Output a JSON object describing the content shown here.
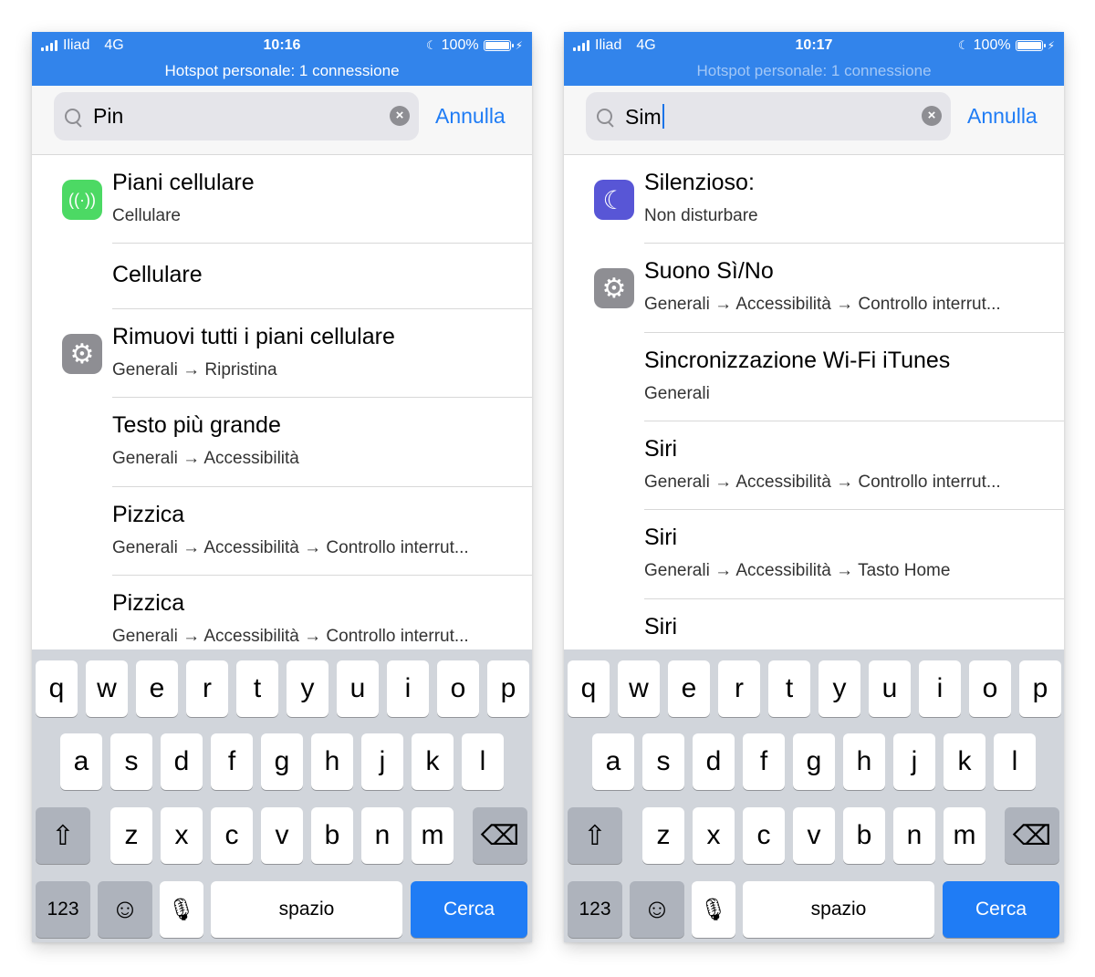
{
  "phones": [
    {
      "status": {
        "carrier": "Iliad",
        "network": "4G",
        "time": "10:16",
        "battery": "100%",
        "hotspot": "Hotspot personale: 1 connessione"
      },
      "search": {
        "query": "Pin",
        "cancel_label": "Annulla"
      },
      "results": [
        {
          "title": "Piani cellulare",
          "subtitle": "Cellulare",
          "icon": "antenna-icon"
        },
        {
          "title": "Cellulare",
          "subtitle": ""
        },
        {
          "title": "Rimuovi tutti i piani cellulare",
          "subtitle": "Generali → Ripristina",
          "icon": "settings-gear-icon"
        },
        {
          "title": "Testo più grande",
          "subtitle": "Generali → Accessibilità"
        },
        {
          "title": "Pizzica",
          "subtitle": "Generali → Accessibilità → Controllo interrut..."
        },
        {
          "title": "Pizzica",
          "subtitle": "Generali → Accessibilità → Controllo interrut..."
        }
      ]
    },
    {
      "status": {
        "carrier": "Iliad",
        "network": "4G",
        "time": "10:17",
        "battery": "100%",
        "hotspot": "Hotspot personale: 1 connessione"
      },
      "search": {
        "query": "Sim",
        "cancel_label": "Annulla"
      },
      "results": [
        {
          "title": "Silenzioso:",
          "subtitle": "Non disturbare",
          "icon": "moon-icon"
        },
        {
          "title": "Suono Sì/No",
          "subtitle": "Generali → Accessibilità → Controllo interrut...",
          "icon": "settings-gear-icon"
        },
        {
          "title": "Sincronizzazione Wi-Fi iTunes",
          "subtitle": "Generali"
        },
        {
          "title": "Siri",
          "subtitle": "Generali → Accessibilità → Controllo interrut..."
        },
        {
          "title": "Siri",
          "subtitle": "Generali → Accessibilità → Tasto Home"
        },
        {
          "title": "Siri",
          "subtitle": ""
        }
      ]
    }
  ],
  "keyboard": {
    "row1": [
      "q",
      "w",
      "e",
      "r",
      "t",
      "y",
      "u",
      "i",
      "o",
      "p"
    ],
    "row2": [
      "a",
      "s",
      "d",
      "f",
      "g",
      "h",
      "j",
      "k",
      "l"
    ],
    "row3": [
      "z",
      "x",
      "c",
      "v",
      "b",
      "n",
      "m"
    ],
    "shift_icon": "shift-icon",
    "backspace_icon": "backspace-icon",
    "numbers_label": "123",
    "emoji_icon": "emoji-icon",
    "mic_icon": "microphone-icon",
    "space_label": "spazio",
    "search_label": "Cerca"
  },
  "colors": {
    "status_bar": "#3284eb",
    "accent": "#1f7cf5",
    "keyboard_bg": "#d1d5db"
  }
}
